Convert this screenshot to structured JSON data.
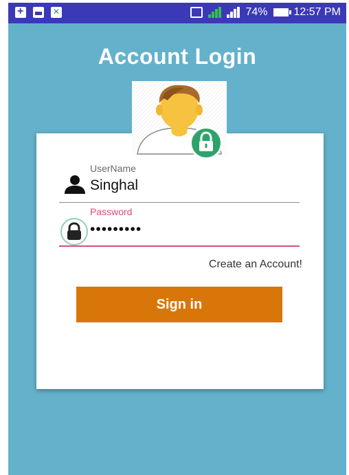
{
  "status_bar": {
    "battery_percent": "74%",
    "time": "12:57 PM",
    "icons": [
      "battery-plus-icon",
      "image-icon",
      "x-app-icon",
      "vibrate-icon",
      "signal-icon",
      "signal-icon",
      "battery-icon"
    ]
  },
  "header": {
    "title": "Account Login"
  },
  "avatar": {
    "icon": "user-avatar-icon",
    "badge_icon": "lock-icon",
    "badge_color": "#2da36b"
  },
  "form": {
    "username": {
      "label": "UserName",
      "value": "Singhal",
      "icon": "person-icon"
    },
    "password": {
      "label": "Password",
      "value": "•••••••••",
      "icon": "lock-icon"
    }
  },
  "links": {
    "create_account": "Create an Account!"
  },
  "buttons": {
    "sign_in": "Sign in"
  },
  "colors": {
    "background": "#64b1cb",
    "status_bar": "#3c39b6",
    "accent": "#d84a7c",
    "button": "#d9760a",
    "badge": "#2da36b"
  }
}
